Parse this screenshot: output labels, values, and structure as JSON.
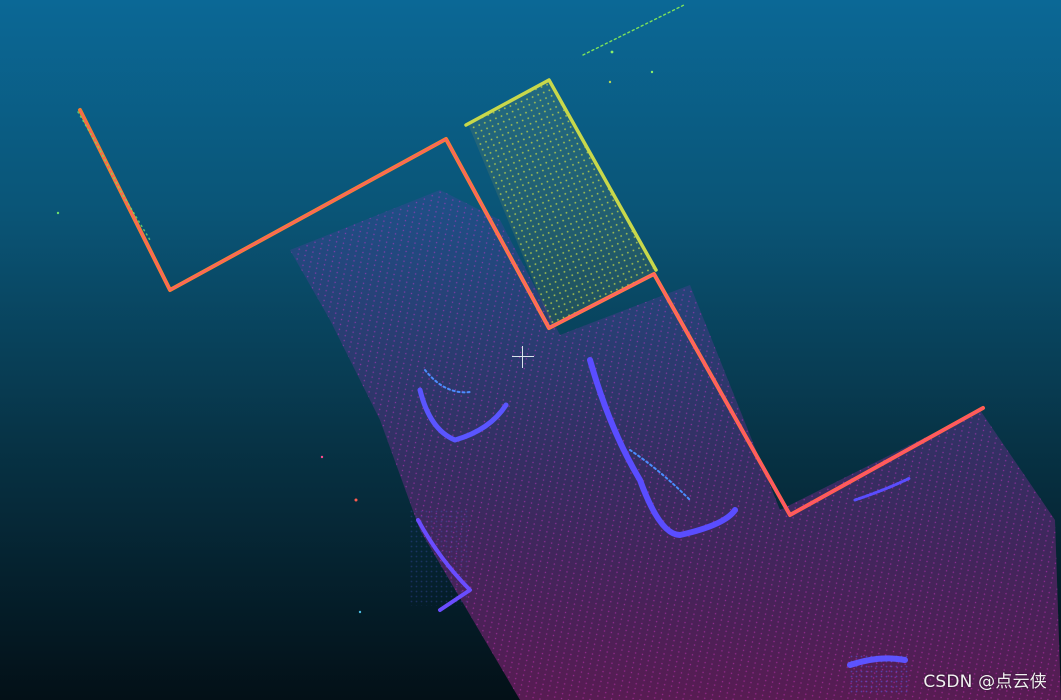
{
  "watermark": {
    "text": "CSDN @点云侠"
  },
  "colors": {
    "background_top": "#0b6896",
    "background_bottom": "#031017",
    "wall_point": "#ff9a3c",
    "ground_point": "#d23bd6",
    "object_point": "#5a4dff",
    "high_point": "#8fff4a"
  },
  "icons": {
    "crosshair": "crosshair-icon"
  }
}
